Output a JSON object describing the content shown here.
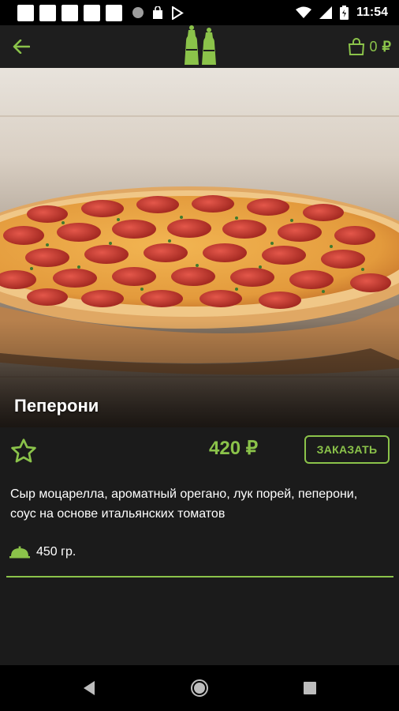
{
  "status_bar": {
    "time": "11:54",
    "notification_icons": [
      "square",
      "square",
      "square",
      "square",
      "square",
      "circle",
      "bag",
      "play-store"
    ],
    "system_icons": [
      "wifi-icon",
      "signal-icon",
      "battery-icon"
    ]
  },
  "app_bar": {
    "back_icon": "arrow-left-icon",
    "logo": "pepper-mill-logo",
    "cart_icon": "shopping-bag-icon",
    "cart_count": "0",
    "currency": "₽",
    "accent_color": "#8bc34a"
  },
  "product": {
    "name": "Пеперони",
    "price": "420 ₽",
    "order_label": "ЗАКАЗАТЬ",
    "favorite_icon": "star-outline-icon",
    "description": "Сыр моцарелла, ароматный орегано, лук порей, пеперони, соус на основе итальянских томатов",
    "weight_icon": "dish-cover-icon",
    "weight": "450 гр."
  },
  "nav_bar": {
    "icons": [
      "nav-back-icon",
      "nav-home-icon",
      "nav-recent-icon"
    ]
  }
}
